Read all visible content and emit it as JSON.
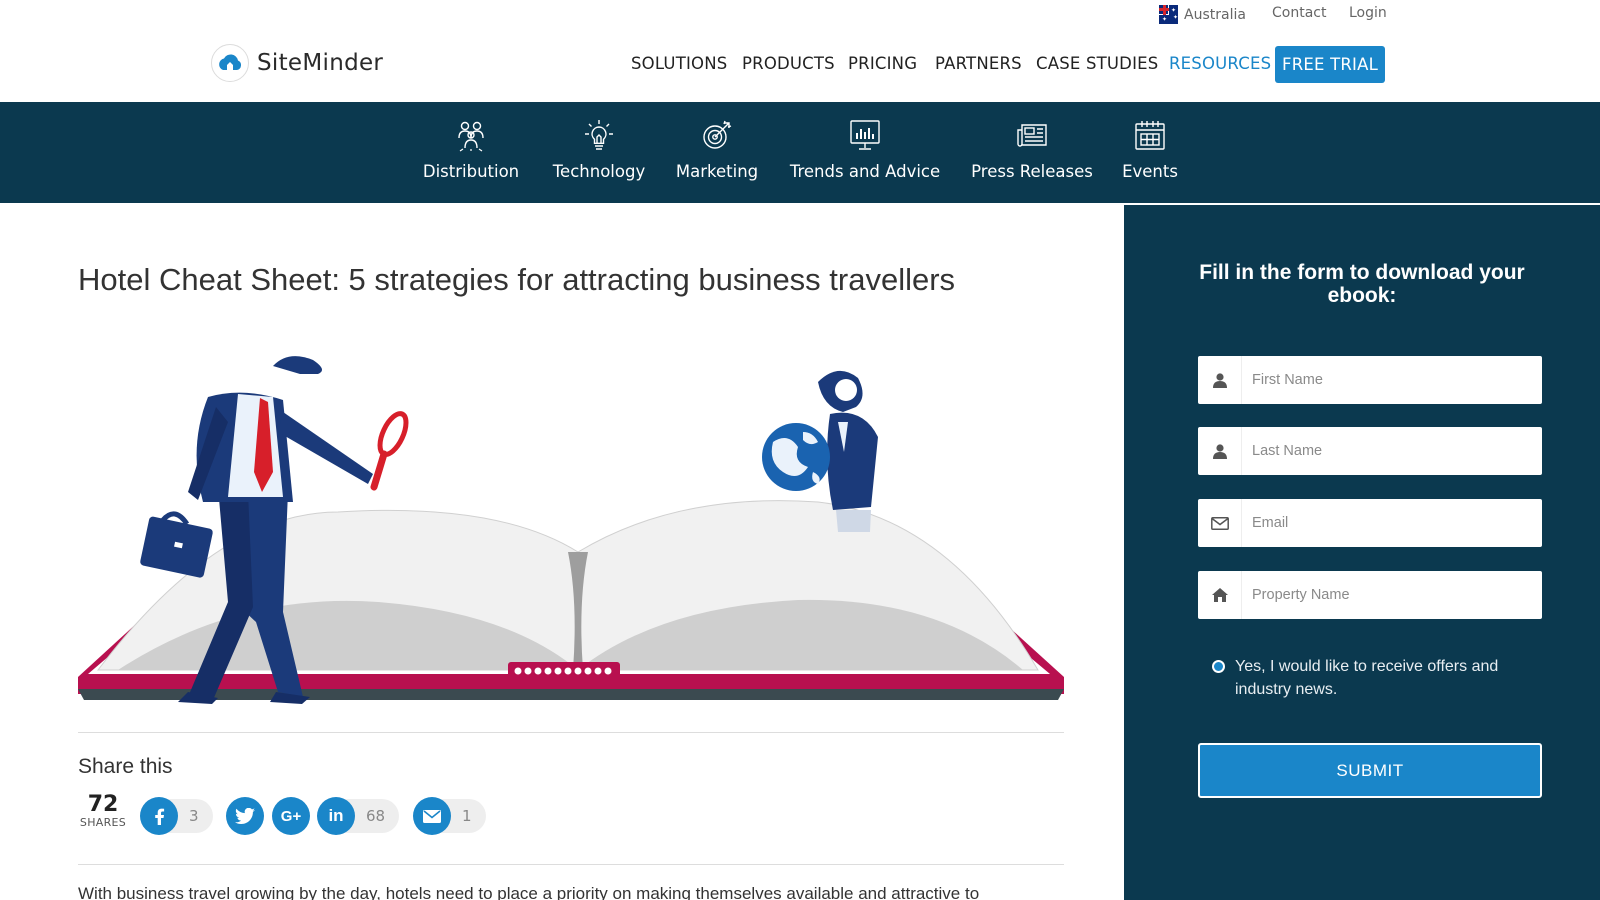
{
  "utility": {
    "region": "Australia",
    "contact": "Contact",
    "login": "Login"
  },
  "header": {
    "brand": "SiteMinder",
    "nav": [
      "SOLUTIONS",
      "PRODUCTS",
      "PRICING",
      "PARTNERS",
      "CASE STUDIES",
      "RESOURCES"
    ],
    "active_nav": "RESOURCES",
    "cta": "FREE TRIAL"
  },
  "subnav": {
    "items": [
      {
        "label": "Distribution",
        "icon": "people-group-icon"
      },
      {
        "label": "Technology",
        "icon": "lightbulb-icon"
      },
      {
        "label": "Marketing",
        "icon": "target-icon"
      },
      {
        "label": "Trends and Advice",
        "icon": "presentation-chart-icon"
      },
      {
        "label": "Press Releases",
        "icon": "newspaper-icon"
      },
      {
        "label": "Events",
        "icon": "calendar-icon"
      }
    ]
  },
  "article": {
    "title": "Hotel Cheat Sheet: 5 strategies for attracting business travellers",
    "share_title": "Share this",
    "share_total": "72",
    "share_total_label": "SHARES",
    "shares": [
      {
        "network": "facebook",
        "icon": "facebook-icon",
        "count": "3"
      },
      {
        "network": "twitter",
        "icon": "twitter-icon",
        "count": ""
      },
      {
        "network": "googleplus",
        "icon": "google-plus-icon",
        "count": ""
      },
      {
        "network": "linkedin",
        "icon": "linkedin-icon",
        "count": "68"
      },
      {
        "network": "email",
        "icon": "email-icon",
        "count": "1"
      }
    ],
    "body_start": "With business travel growing by the day, hotels need to place a priority on making themselves available and attractive to"
  },
  "form": {
    "title": "Fill in the form to download your ebook:",
    "fields": {
      "first_name": {
        "placeholder": "First Name",
        "icon": "user-icon"
      },
      "last_name": {
        "placeholder": "Last Name",
        "icon": "user-icon"
      },
      "email": {
        "placeholder": "Email",
        "icon": "envelope-icon"
      },
      "property": {
        "placeholder": "Property Name",
        "icon": "home-icon"
      }
    },
    "consent": "Yes, I would like to receive offers and industry news.",
    "submit": "SUBMIT"
  },
  "colors": {
    "brand_blue": "#1a86c9",
    "navy": "#0b394f",
    "book_red": "#b8104f"
  }
}
